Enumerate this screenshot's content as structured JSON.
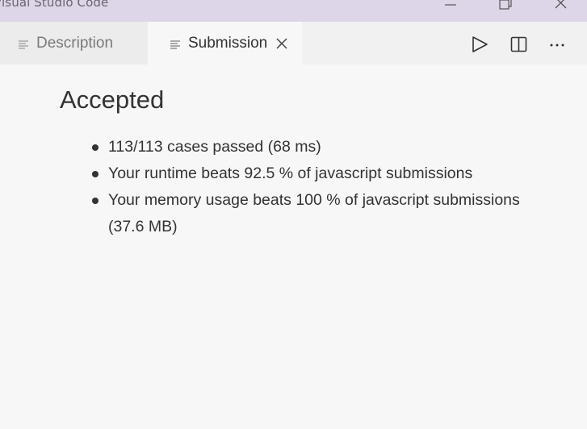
{
  "window": {
    "title": "Visual Studio Code"
  },
  "tabs": [
    {
      "label": "Description",
      "active": false,
      "icon": "preview-lines-icon"
    },
    {
      "label": "Submission",
      "active": true,
      "icon": "preview-lines-icon"
    }
  ],
  "toolbar": {
    "run_icon": "play-icon",
    "split_icon": "split-editor-icon",
    "more_icon": "ellipsis-icon"
  },
  "result": {
    "status": "Accepted",
    "items": [
      "113/113 cases passed (68 ms)",
      "Your runtime beats 92.5 % of javascript submissions",
      "Your memory usage beats 100 % of javascript submissions (37.6 MB)"
    ]
  },
  "colors": {
    "titlebar": "#ddd6e8",
    "editor_background": "#f7f7f7",
    "inactive_tab": "#ececec",
    "text": "#333333"
  }
}
